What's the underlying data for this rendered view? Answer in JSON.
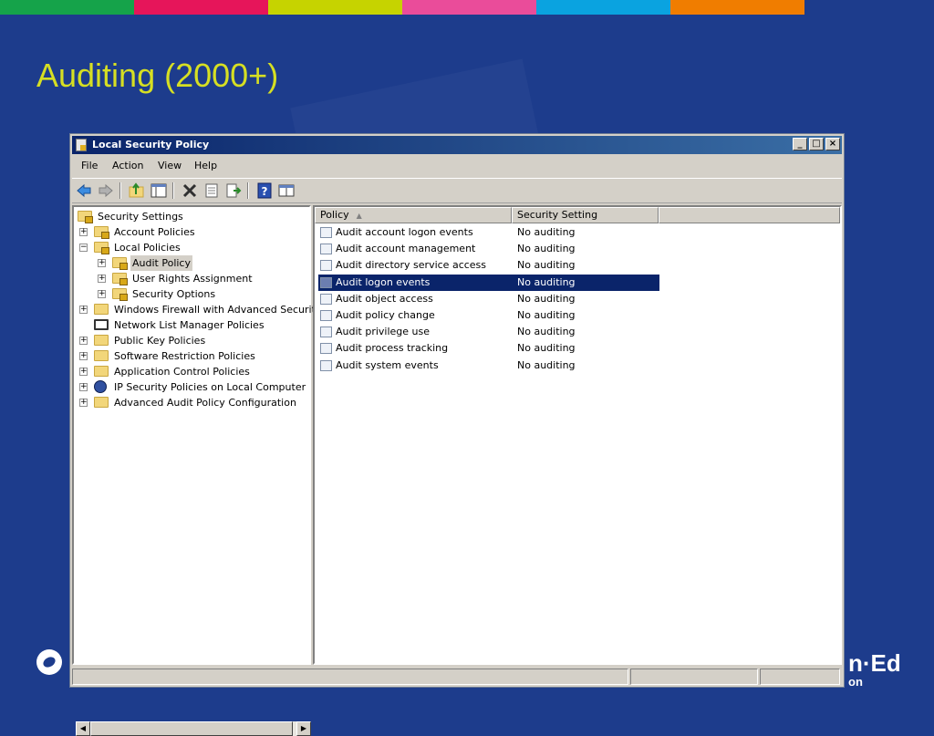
{
  "slide": {
    "title": "Auditing (2000+)",
    "colors": [
      "#15a34a",
      "#e6155a",
      "#c6d300",
      "#ea4c9a",
      "#0aa3e0",
      "#f07d00",
      "#1d3c8c"
    ],
    "brand_right_text": "n·Ed",
    "brand_right_sub": "on"
  },
  "window": {
    "title": "Local Security Policy",
    "controls": {
      "minimize": "_",
      "maximize": "□",
      "close": "×"
    },
    "menu": [
      "File",
      "Action",
      "View",
      "Help"
    ],
    "toolbar_icons": [
      "back-arrow-icon",
      "forward-arrow-icon",
      "up-folder-icon",
      "show-hide-tree-icon",
      "delete-icon",
      "properties-icon",
      "export-list-icon",
      "help-icon",
      "view-icon"
    ]
  },
  "tree": [
    {
      "label": "Security Settings",
      "icon": "security-settings-icon",
      "expander": ""
    },
    {
      "label": "Account Policies",
      "icon": "folder-lock-icon",
      "expander": "+"
    },
    {
      "label": "Local Policies",
      "icon": "folder-lock-icon",
      "expander": "−"
    },
    {
      "label": "Audit Policy",
      "icon": "folder-lock-icon",
      "expander": "+",
      "selected": true
    },
    {
      "label": "User Rights Assignment",
      "icon": "folder-lock-icon",
      "expander": "+"
    },
    {
      "label": "Security Options",
      "icon": "folder-lock-icon",
      "expander": "+"
    },
    {
      "label": "Windows Firewall with Advanced Security",
      "icon": "folder-icon",
      "expander": "+"
    },
    {
      "label": "Network List Manager Policies",
      "icon": "folder-icon",
      "expander": ""
    },
    {
      "label": "Public Key Policies",
      "icon": "folder-icon",
      "expander": "+"
    },
    {
      "label": "Software Restriction Policies",
      "icon": "folder-icon",
      "expander": "+"
    },
    {
      "label": "Application Control Policies",
      "icon": "folder-icon",
      "expander": "+"
    },
    {
      "label": "IP Security Policies on Local Computer",
      "icon": "ip-security-icon",
      "expander": "+"
    },
    {
      "label": "Advanced Audit Policy Configuration",
      "icon": "folder-icon",
      "expander": "+"
    }
  ],
  "list": {
    "columns": [
      "Policy",
      "Security Setting"
    ],
    "sort_indicator": "▲",
    "rows": [
      {
        "policy": "Audit account logon events",
        "setting": "No auditing"
      },
      {
        "policy": "Audit account management",
        "setting": "No auditing"
      },
      {
        "policy": "Audit directory service access",
        "setting": "No auditing"
      },
      {
        "policy": "Audit logon events",
        "setting": "No auditing",
        "selected": true
      },
      {
        "policy": "Audit object access",
        "setting": "No auditing"
      },
      {
        "policy": "Audit policy change",
        "setting": "No auditing"
      },
      {
        "policy": "Audit privilege use",
        "setting": "No auditing"
      },
      {
        "policy": "Audit process tracking",
        "setting": "No auditing"
      },
      {
        "policy": "Audit system events",
        "setting": "No auditing"
      }
    ]
  }
}
